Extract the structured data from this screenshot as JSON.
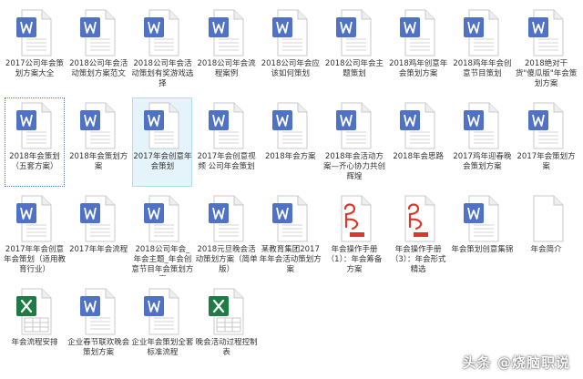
{
  "colors": {
    "word": "#4f72c6",
    "pdf": "#d9382a",
    "excel": "#1f7b45",
    "selected_bg": "#e5f3fb"
  },
  "files": [
    {
      "label": "2017公司年会策划方案大全",
      "icon": "word-doc-icon",
      "selected": false
    },
    {
      "label": "2018公司年会活动策划方案范文",
      "icon": "word-doc-icon",
      "selected": false
    },
    {
      "label": "2018公司年会活动策划有奖游戏选择",
      "icon": "word-doc-icon",
      "selected": false
    },
    {
      "label": "2018公司年会流程案例",
      "icon": "word-doc-icon",
      "selected": false
    },
    {
      "label": "2018公司年会应该如何策划",
      "icon": "word-doc-icon",
      "selected": false
    },
    {
      "label": "2018公司年会主题策划",
      "icon": "word-doc-icon",
      "selected": false
    },
    {
      "label": "2018鸡年创意年会策划方案",
      "icon": "word-doc-icon",
      "selected": false
    },
    {
      "label": "2018鸡年年会创意节目策划",
      "icon": "word-doc-icon",
      "selected": false
    },
    {
      "label": "2018绝对干货\"傻瓜版\"年会策划方案",
      "icon": "word-doc-icon",
      "selected": false
    },
    {
      "label": "2018年会策划（五套方案）",
      "icon": "word-doc-icon",
      "selected": false,
      "focused": true
    },
    {
      "label": "2018年会策划方案",
      "icon": "word-doc-icon",
      "selected": false
    },
    {
      "label": "2017年会创意年会策划",
      "icon": "word-doc-icon",
      "selected": true
    },
    {
      "label": "2017年会创意视频 公司年会策划",
      "icon": "word-doc-icon",
      "selected": false
    },
    {
      "label": "2018年会方案",
      "icon": "word-doc-icon",
      "selected": false
    },
    {
      "label": "2018年会活动方案—齐心协力共创辉煌",
      "icon": "word-doc-icon",
      "selected": false
    },
    {
      "label": "2018年会思路",
      "icon": "word-doc-icon",
      "selected": false
    },
    {
      "label": "2017鸡年迎春晚会策划方案",
      "icon": "word-doc-icon",
      "selected": false
    },
    {
      "label": "2017年会策划方案",
      "icon": "word-doc-icon",
      "selected": false
    },
    {
      "label": "2017年年会创意年会策划（适用教育行业）",
      "icon": "word-doc-icon",
      "selected": false
    },
    {
      "label": "2017年年会流程",
      "icon": "word-doc-icon",
      "selected": false
    },
    {
      "label": "2018公司年会_年会主题_年会创意节目年会策划方案",
      "icon": "word-doc-icon",
      "selected": false
    },
    {
      "label": "2018元旦晚会活动策划方案（简单版）",
      "icon": "word-doc-icon",
      "selected": false
    },
    {
      "label": "某教育集团2017年年会活动策划方案",
      "icon": "word-doc-icon",
      "selected": false
    },
    {
      "label": "年会操作手册（1）：年会筹备方案",
      "icon": "pdf-doc-icon",
      "selected": false
    },
    {
      "label": "年会操作手册（3）：年会形式精选",
      "icon": "pdf-doc-icon",
      "selected": false
    },
    {
      "label": "年会策划创意集锦",
      "icon": "word-doc-icon",
      "selected": false
    },
    {
      "label": "年会简介",
      "icon": "blank-doc-icon",
      "selected": false
    },
    {
      "label": "年会流程安排",
      "icon": "excel-sheet-icon",
      "selected": false
    },
    {
      "label": "企业春节联欢晚会策划方案",
      "icon": "word-doc-icon",
      "selected": false
    },
    {
      "label": "企业年会策划全套标准流程",
      "icon": "word-doc-icon",
      "selected": false
    },
    {
      "label": "晚会活动过程控制表",
      "icon": "excel-sheet-icon",
      "selected": false
    }
  ],
  "watermark": "头条 @烧脑职说"
}
